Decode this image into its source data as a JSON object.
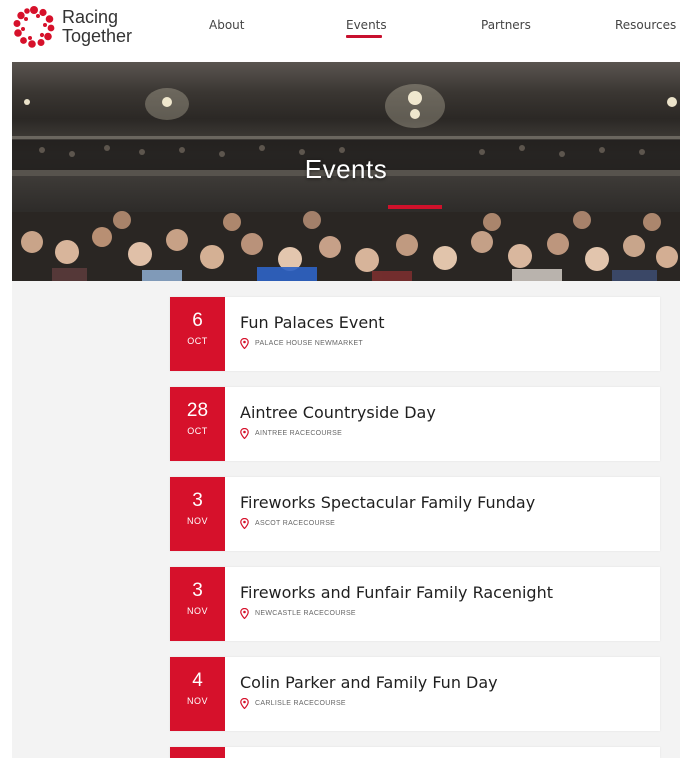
{
  "brand": {
    "name_line1": "Racing",
    "name_line2": "Together",
    "accent_color": "#d6112b"
  },
  "nav": {
    "items": [
      {
        "label": "About",
        "active": false
      },
      {
        "label": "Events",
        "active": true
      },
      {
        "label": "Partners",
        "active": false
      },
      {
        "label": "Resources",
        "active": false
      }
    ]
  },
  "hero": {
    "title": "Events"
  },
  "events": [
    {
      "day": "6",
      "month": "OCT",
      "title": "Fun Palaces Event",
      "location": "PALACE HOUSE NEWMARKET"
    },
    {
      "day": "28",
      "month": "OCT",
      "title": "Aintree Countryside Day",
      "location": "AINTREE RACECOURSE"
    },
    {
      "day": "3",
      "month": "NOV",
      "title": "Fireworks Spectacular Family Funday",
      "location": "ASCOT RACECOURSE"
    },
    {
      "day": "3",
      "month": "NOV",
      "title": "Fireworks and Funfair Family Racenight",
      "location": "NEWCASTLE RACECOURSE"
    },
    {
      "day": "4",
      "month": "NOV",
      "title": "Colin Parker and Family Fun Day",
      "location": "CARLISLE RACECOURSE"
    }
  ],
  "icons": {
    "logo": "ring-of-dots-logo-icon",
    "location": "map-pin-icon"
  }
}
